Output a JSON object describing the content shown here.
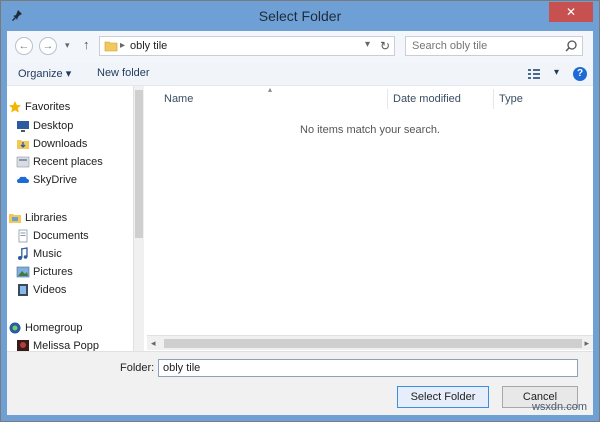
{
  "window": {
    "title": "Select Folder",
    "close_glyph": "✕"
  },
  "address": {
    "path": "obly tile"
  },
  "search": {
    "placeholder": "Search obly tile"
  },
  "toolbar": {
    "organize": "Organize ▾",
    "new_folder": "New folder",
    "view_dropdown": "▾",
    "help": "?"
  },
  "nav": {
    "favorites": {
      "label": "Favorites",
      "items": [
        "Desktop",
        "Downloads",
        "Recent places",
        "SkyDrive"
      ]
    },
    "libraries": {
      "label": "Libraries",
      "items": [
        "Documents",
        "Music",
        "Pictures",
        "Videos"
      ]
    },
    "homegroup": {
      "label": "Homegroup",
      "items": [
        "Melissa Popp"
      ]
    }
  },
  "list": {
    "columns": [
      "Name",
      "Date modified",
      "Type"
    ],
    "empty_text": "No items match your search."
  },
  "bottom": {
    "folder_label": "Folder:",
    "folder_value": "obly tile",
    "select_button": "Select Folder",
    "cancel_button": "Cancel"
  },
  "watermark": "wsxdn.com",
  "colors": {
    "title_bar": "#6ea0d6",
    "close_button": "#c75050",
    "accent": "#1e6bd6"
  }
}
